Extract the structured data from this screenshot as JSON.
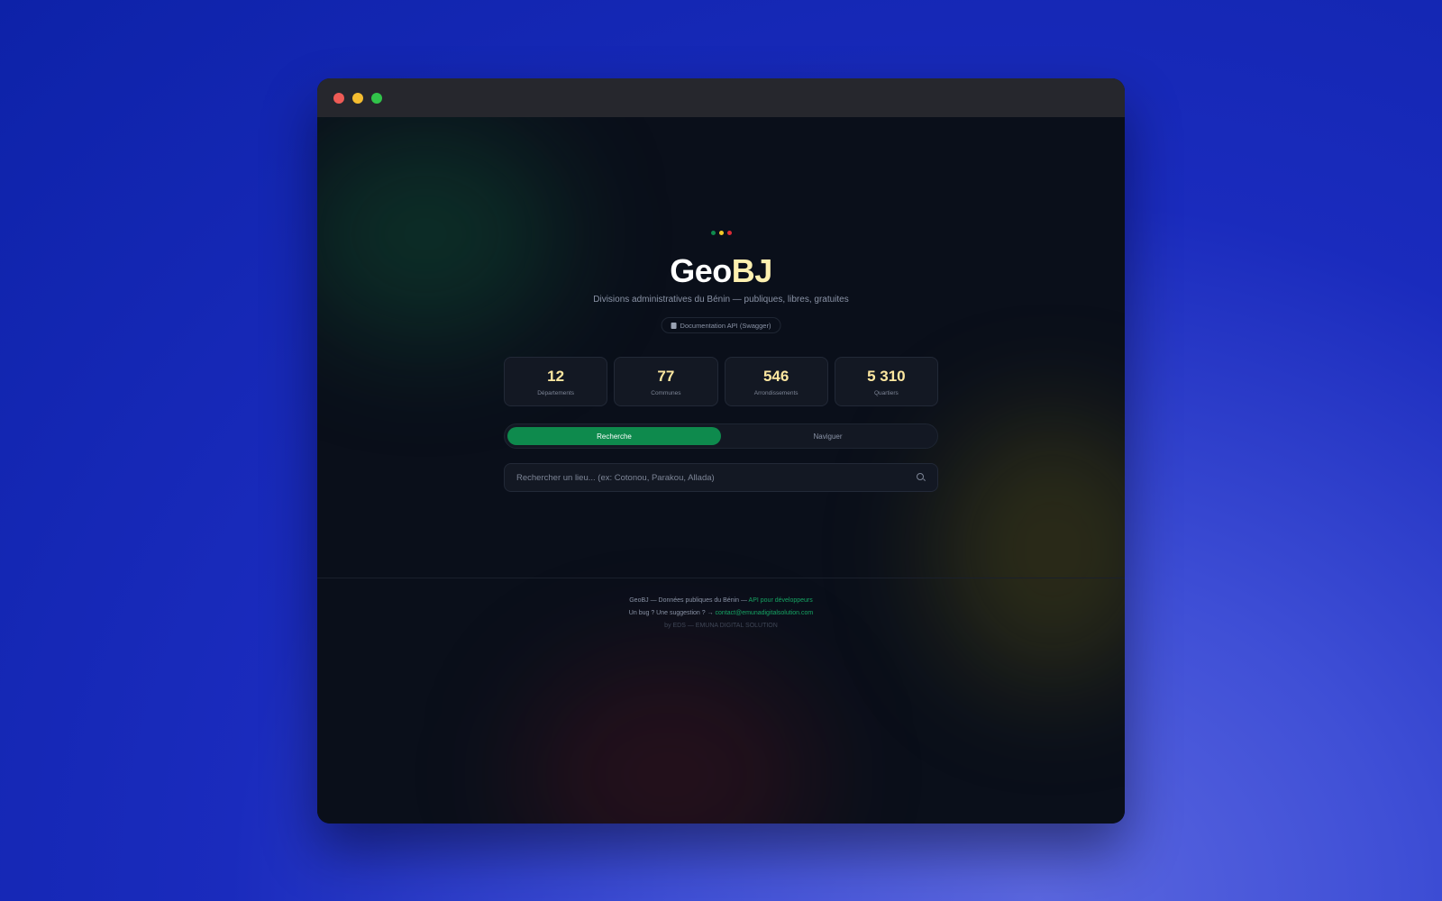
{
  "app": {
    "name_part1": "Geo",
    "name_part2": "BJ",
    "subtitle": "Divisions administratives du Bénin — publiques, libres, gratuites",
    "doc_link": "Documentation API (Swagger)"
  },
  "window": {
    "traffic_lights": [
      "#ee5b56",
      "#f4bd30",
      "#31c44a"
    ]
  },
  "flag_colors": [
    "#0e8a4d",
    "#f3c928",
    "#dc2b36"
  ],
  "stats": [
    {
      "value": "12",
      "label": "Départements"
    },
    {
      "value": "77",
      "label": "Communes"
    },
    {
      "value": "546",
      "label": "Arrondissements"
    },
    {
      "value": "5 310",
      "label": "Quartiers"
    }
  ],
  "tabs": [
    {
      "label": "Recherche",
      "active": true
    },
    {
      "label": "Naviguer",
      "active": false
    }
  ],
  "search": {
    "placeholder": "Rechercher un lieu... (ex: Cotonou, Parakou, Allada)",
    "value": ""
  },
  "footer": {
    "line1_text": "GeoBJ — Données publiques du Bénin — ",
    "line1_link": "API pour développeurs",
    "line2_text": "Un bug ? Une suggestion ? → ",
    "line2_link": "contact@emunadigitalsolution.com",
    "line3": "by EDS — EMUNA DIGITAL SOLUTION"
  },
  "colors": {
    "accent": "#0e8a4d",
    "stat_value": "#fde7a0",
    "link": "#16a463"
  }
}
